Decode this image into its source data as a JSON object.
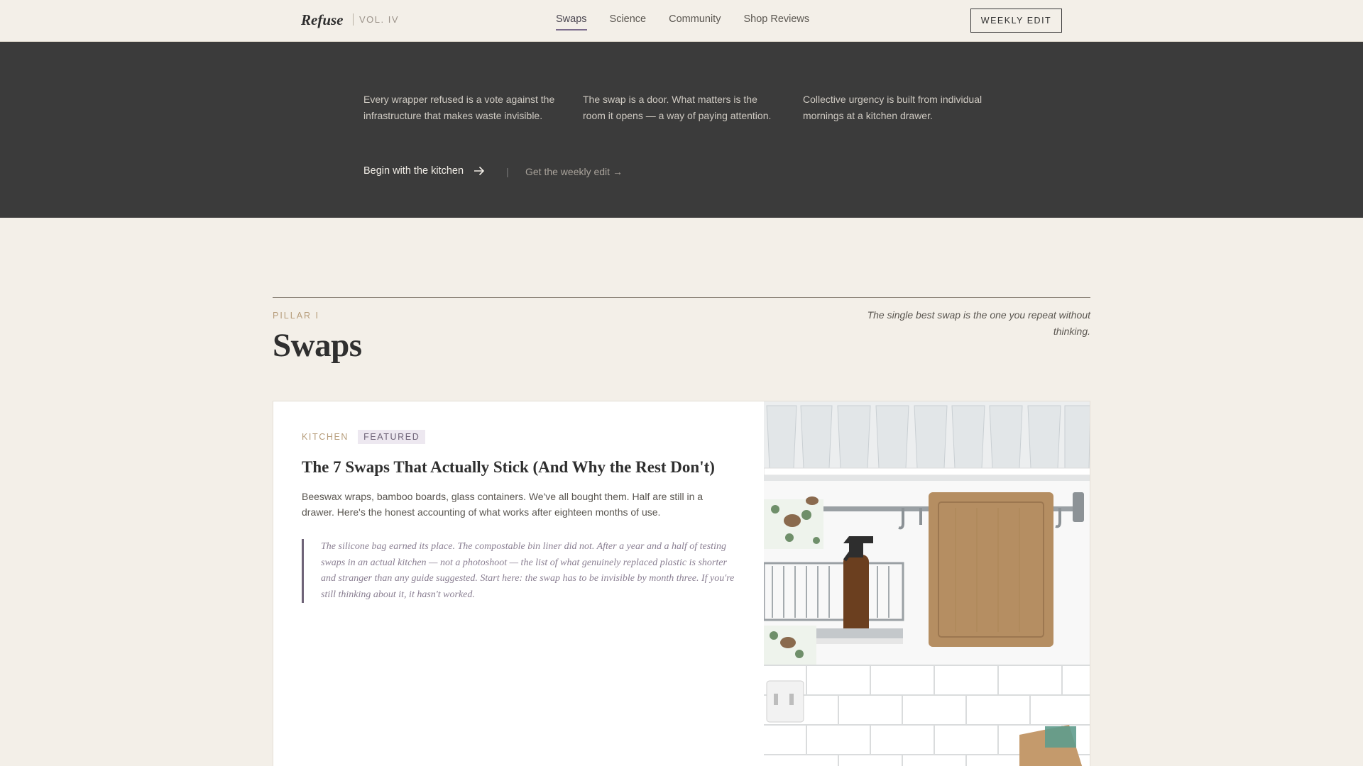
{
  "header": {
    "brand": "Refuse",
    "volume": "VOL. IV",
    "nav": [
      "Swaps",
      "Science",
      "Community",
      "Shop Reviews"
    ],
    "active_nav": "Swaps",
    "weekly_button": "WEEKLY EDIT"
  },
  "hero": {
    "quotes": [
      "Every wrapper refused is a vote against the infrastructure that makes waste invisible.",
      "The swap is a door. What matters is the room it opens — a way of paying attention.",
      "Collective urgency is built from individual mornings at a kitchen drawer."
    ],
    "cta_primary": "Begin with the kitchen",
    "cta_secondary": "Get the weekly edit →"
  },
  "section": {
    "eyebrow": "PILLAR I",
    "title": "Swaps",
    "tagline": "The single best swap is the one you repeat without thinking."
  },
  "featured": {
    "category": "KITCHEN",
    "badge": "FEATURED",
    "title": "The 7 Swaps That Actually Stick (And Why the Rest Don't)",
    "description": "Beeswax wraps, bamboo boards, glass containers. We've all bought them. Half are still in a drawer. Here's the honest accounting of what works after eighteen months of use.",
    "pullquote": "The silicone bag earned its place. The compostable bin liner did not. After a year and a half of testing swaps in an actual kitchen — not a photoshoot — the list of what genuinely replaced plastic is shorter and stranger than any guide suggested. Start here: the swap has to be invisible by month three. If you're still thinking about it, it hasn't worked."
  },
  "colors": {
    "background": "#f3efe8",
    "dark_band": "#3b3b3b",
    "accent_purple": "#6e6377",
    "accent_tan": "#b79e7c"
  }
}
